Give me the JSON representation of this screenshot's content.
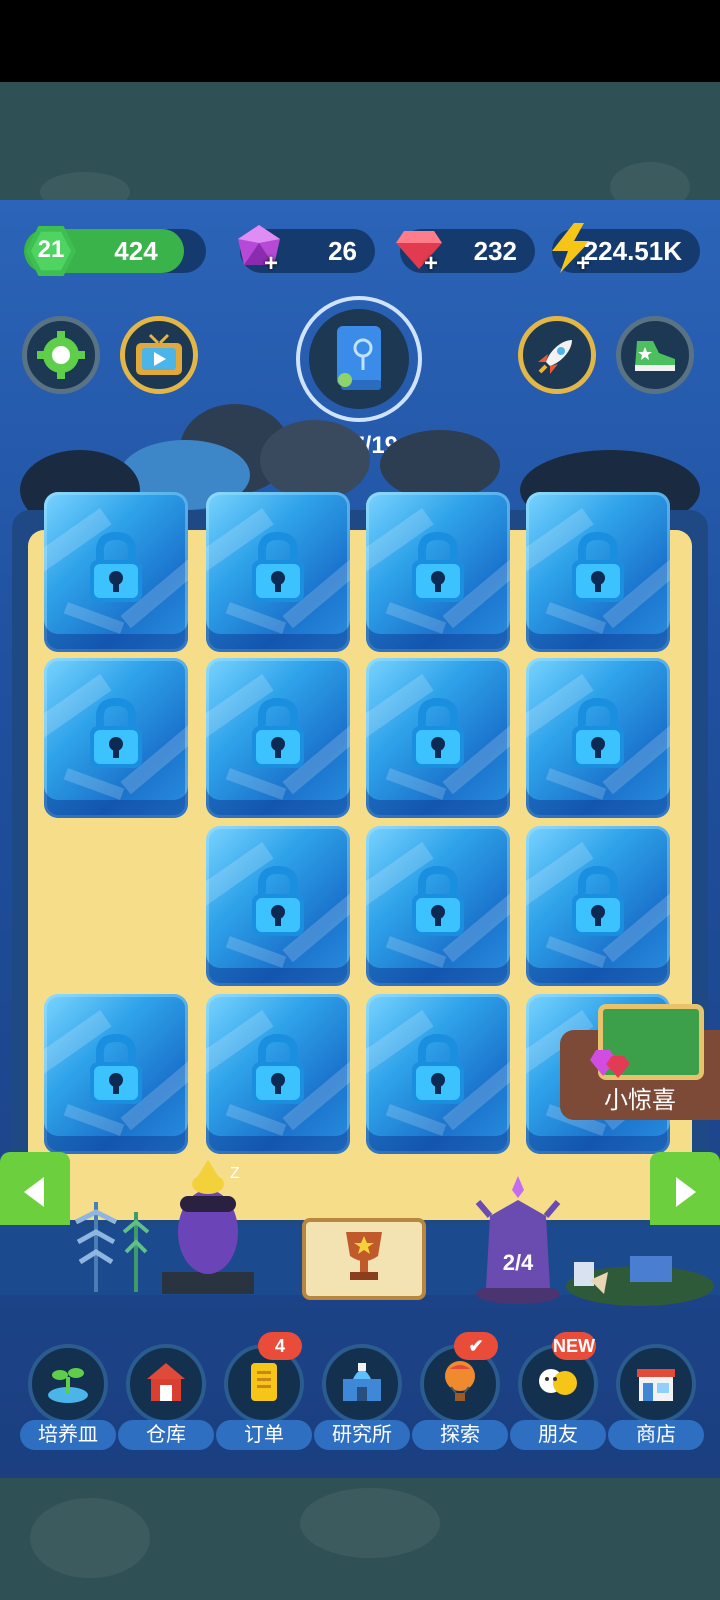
{
  "hud": {
    "level": "21",
    "xp": "424",
    "purple_gems": "26",
    "red_gems": "232",
    "energy": "224.51K"
  },
  "top_buttons": {
    "settings": "gear-icon",
    "video": "tv-icon",
    "rocket": "rocket-icon",
    "shoe": "sneaker-icon"
  },
  "collection": {
    "progress": "17/19"
  },
  "board": {
    "locked_cells": 15,
    "cell_icon": "lock-icon"
  },
  "side": {
    "surprise_label": "小惊喜"
  },
  "scene": {
    "statue_progress": "2/4"
  },
  "nav": {
    "items": [
      {
        "label": "培养皿",
        "icon": "sprout-icon",
        "badge": ""
      },
      {
        "label": "仓库",
        "icon": "barn-icon",
        "badge": ""
      },
      {
        "label": "订单",
        "icon": "scroll-icon",
        "badge": "4"
      },
      {
        "label": "研究所",
        "icon": "lab-icon",
        "badge": ""
      },
      {
        "label": "探索",
        "icon": "balloon-icon",
        "badge": "✔"
      },
      {
        "label": "朋友",
        "icon": "friends-icon",
        "badge": "NEW"
      },
      {
        "label": "商店",
        "icon": "shop-icon",
        "badge": ""
      }
    ]
  },
  "colors": {
    "panel": "#2b64b8",
    "board": "#f5dd8a",
    "cube": "#2fa3ea",
    "arrow": "#6ccf3e"
  }
}
